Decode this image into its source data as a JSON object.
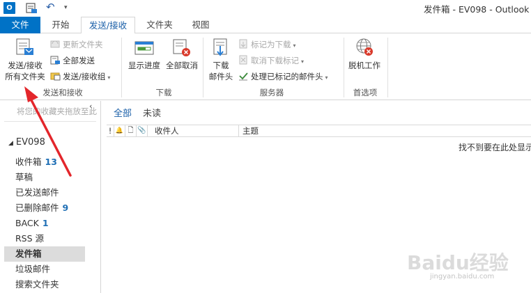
{
  "window": {
    "title": "发件箱 - EV098 - Outlook"
  },
  "qat": {
    "outlook_letter": "O"
  },
  "tabs": {
    "file": "文件",
    "home": "开始",
    "send_receive": "发送/接收",
    "folder": "文件夹",
    "view": "视图"
  },
  "ribbon": {
    "group_send_receive": {
      "label": "发送和接收",
      "send_all_line1": "发送/接收",
      "send_all_line2": "所有文件夹",
      "update_folder": "更新文件夹",
      "send_all": "全部发送",
      "send_receive_groups": "发送/接收组"
    },
    "group_download": {
      "label": "下载",
      "show_progress": "显示进度",
      "cancel_all": "全部取消"
    },
    "group_server": {
      "label": "服务器",
      "download_headers_line1": "下载",
      "download_headers_line2": "邮件头",
      "mark_to_download": "标记为下载",
      "unmark_to_download": "取消下载标记",
      "process_marked_headers": "处理已标记的邮件头"
    },
    "group_preferences": {
      "label": "首选项",
      "work_offline": "脱机工作"
    }
  },
  "nav": {
    "drag_hint": "将您的收藏夹拖放至此",
    "collapse_glyph": "‹",
    "account": "EV098",
    "folders": [
      {
        "name": "收件箱",
        "count": "13"
      },
      {
        "name": "草稿",
        "count": ""
      },
      {
        "name": "已发送邮件",
        "count": ""
      },
      {
        "name": "已删除邮件",
        "count": "9"
      },
      {
        "name": "BACK",
        "count": "1"
      },
      {
        "name": "RSS 源",
        "count": ""
      },
      {
        "name": "发件箱",
        "count": ""
      },
      {
        "name": "垃圾邮件",
        "count": ""
      },
      {
        "name": "搜索文件夹",
        "count": ""
      }
    ],
    "selected_folder": "发件箱"
  },
  "main": {
    "filter_all": "全部",
    "filter_unread": "未读",
    "columns": {
      "importance": "!",
      "reminder": "🔔",
      "icon": "🗋",
      "attachment": "📎",
      "to": "收件人",
      "subject": "主题"
    },
    "empty_message": "找不到要在此处显示的项目。"
  },
  "watermark": {
    "text": "Baidu经验",
    "url": "jingyan.baidu.com"
  },
  "colors": {
    "accent": "#0072c6",
    "arrow": "#e3262b",
    "count": "#1f6fb5"
  }
}
